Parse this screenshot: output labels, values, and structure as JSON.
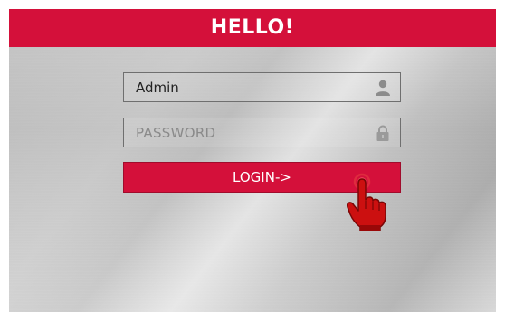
{
  "header": {
    "title": "HELLO!"
  },
  "login_form": {
    "username": {
      "value": "Admin",
      "icon": "user-icon"
    },
    "password": {
      "placeholder": "PASSWORD",
      "icon": "lock-icon"
    },
    "login_button": {
      "label": "LOGIN->"
    }
  },
  "colors": {
    "accent_red": "#d4103a",
    "field_border": "#6f6f6f",
    "brushed_metal": "#c9c9c9"
  },
  "cursor": {
    "icon": "pointing-hand-icon"
  }
}
